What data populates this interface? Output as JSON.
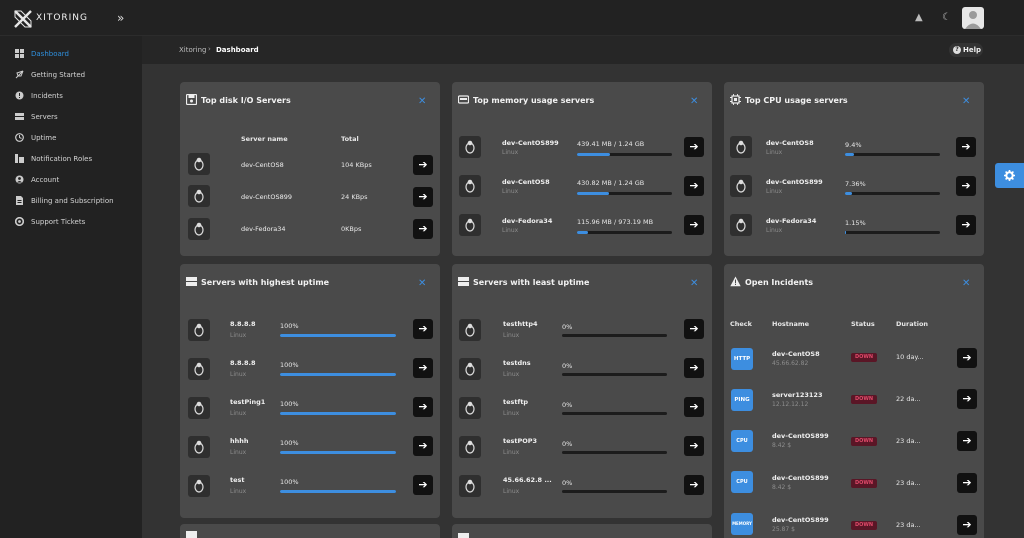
{
  "app": {
    "brand": "XITORING"
  },
  "sidebar": {
    "items": [
      {
        "label": "Dashboard",
        "icon": "dashboard-icon",
        "active": true
      },
      {
        "label": "Getting Started",
        "icon": "rocket-icon"
      },
      {
        "label": "Incidents",
        "icon": "incidents-icon"
      },
      {
        "label": "Servers",
        "icon": "servers-icon"
      },
      {
        "label": "Uptime",
        "icon": "uptime-icon"
      },
      {
        "label": "Notification Roles",
        "icon": "notification-roles-icon"
      },
      {
        "label": "Account",
        "icon": "account-icon"
      },
      {
        "label": "Billing and Subscription",
        "icon": "billing-icon"
      },
      {
        "label": "Support Tickets",
        "icon": "support-icon"
      }
    ]
  },
  "breadcrumb": {
    "root": "Xitoring",
    "separator": "›",
    "current": "Dashboard"
  },
  "help": {
    "label": "Help",
    "glyph": "?"
  },
  "glyphs": {
    "collapse": "»",
    "bell": "▲",
    "moon": "☾",
    "close": "✕",
    "arrow": "➔"
  },
  "colors": {
    "accent": "#3d8ee0",
    "down": "#e04a6a"
  },
  "disk": {
    "title": "Top disk I/O Servers",
    "col_name": "Server name",
    "col_total": "Total",
    "rows": [
      {
        "name": "dev-CentOS8",
        "total": "104 KBps"
      },
      {
        "name": "dev-CentOS899",
        "total": "24 KBps"
      },
      {
        "name": "dev-Fedora34",
        "total": "0KBps"
      }
    ]
  },
  "memory": {
    "title": "Top memory usage servers",
    "rows": [
      {
        "name": "dev-CentOS899",
        "os": "Linux",
        "value": "439.41 MB / 1.24 GB",
        "pct": 35
      },
      {
        "name": "dev-CentOS8",
        "os": "Linux",
        "value": "430.82 MB / 1.24 GB",
        "pct": 34
      },
      {
        "name": "dev-Fedora34",
        "os": "Linux",
        "value": "115.96 MB / 973.19 MB",
        "pct": 12
      }
    ]
  },
  "cpu": {
    "title": "Top CPU usage servers",
    "rows": [
      {
        "name": "dev-CentOS8",
        "os": "Linux",
        "value": "9.4%",
        "pct": 9.4
      },
      {
        "name": "dev-CentOS899",
        "os": "Linux",
        "value": "7.36%",
        "pct": 7.36
      },
      {
        "name": "dev-Fedora34",
        "os": "Linux",
        "value": "1.15%",
        "pct": 1.15
      }
    ]
  },
  "highest": {
    "title": "Servers with highest uptime",
    "rows": [
      {
        "name": "8.8.8.8",
        "os": "Linux",
        "value": "100%",
        "pct": 100
      },
      {
        "name": "8.8.8.8",
        "os": "Linux",
        "value": "100%",
        "pct": 100
      },
      {
        "name": "testPing1",
        "os": "Linux",
        "value": "100%",
        "pct": 100
      },
      {
        "name": "hhhh",
        "os": "Linux",
        "value": "100%",
        "pct": 100
      },
      {
        "name": "test",
        "os": "Linux",
        "value": "100%",
        "pct": 100
      }
    ]
  },
  "least": {
    "title": "Servers with least uptime",
    "rows": [
      {
        "name": "testhttp4",
        "os": "Linux",
        "value": "0%",
        "pct": 0
      },
      {
        "name": "testdns",
        "os": "Linux",
        "value": "0%",
        "pct": 0
      },
      {
        "name": "testftp",
        "os": "Linux",
        "value": "0%",
        "pct": 0
      },
      {
        "name": "testPOP3",
        "os": "Linux",
        "value": "0%",
        "pct": 0
      },
      {
        "name": "45.66.62.8 ...",
        "os": "Linux",
        "value": "0%",
        "pct": 0
      }
    ]
  },
  "incidents": {
    "title": "Open Incidents",
    "col_check": "Check",
    "col_host": "Hostname",
    "col_status": "Status",
    "col_duration": "Duration",
    "rows": [
      {
        "check": "HTTP",
        "host": "dev-CentOS8",
        "ip": "45.66.62.82",
        "status": "DOWN",
        "duration": "10 day..."
      },
      {
        "check": "PING",
        "host": "server123123",
        "ip": "12.12.12.12",
        "status": "DOWN",
        "duration": "22 da..."
      },
      {
        "check": "CPU",
        "host": "dev-CentOS899",
        "ip": "8.42 $",
        "status": "DOWN",
        "duration": "23 da..."
      },
      {
        "check": "CPU",
        "host": "dev-CentOS899",
        "ip": "8.42 $",
        "status": "DOWN",
        "duration": "23 da..."
      },
      {
        "check": "MEMORY",
        "host": "dev-CentOS899",
        "ip": "25.87 $",
        "status": "DOWN",
        "duration": "23 da..."
      }
    ]
  }
}
